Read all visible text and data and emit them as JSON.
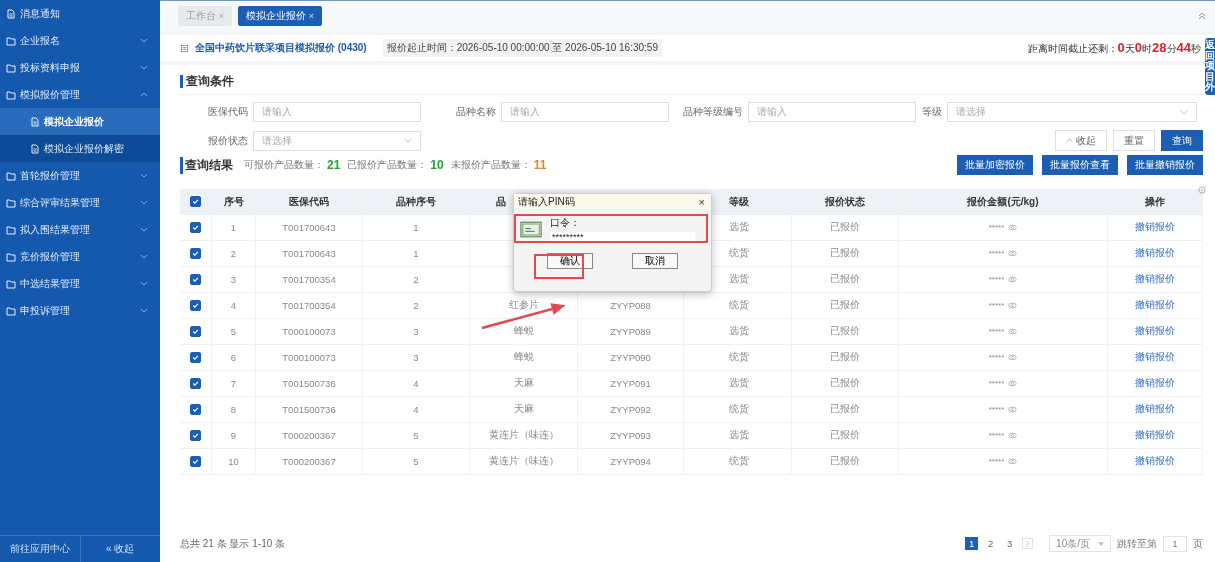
{
  "sidebar": {
    "items": [
      {
        "label": "消息通知",
        "kind": "leaf",
        "selected": false
      },
      {
        "label": "企业报名",
        "kind": "group",
        "expanded": false,
        "selected": false
      },
      {
        "label": "投标资料申报",
        "kind": "group",
        "expanded": false,
        "selected": false
      },
      {
        "label": "模拟报价管理",
        "kind": "group",
        "expanded": true,
        "selected": false,
        "children": [
          {
            "label": "模拟企业报价",
            "kind": "leaf",
            "selected": true
          },
          {
            "label": "模拟企业报价解密",
            "kind": "leaf",
            "selected": false
          }
        ]
      },
      {
        "label": "首轮报价管理",
        "kind": "group",
        "expanded": false,
        "selected": false
      },
      {
        "label": "综合评审结果管理",
        "kind": "group",
        "expanded": false,
        "selected": false
      },
      {
        "label": "拟入围结果管理",
        "kind": "group",
        "expanded": false,
        "selected": false
      },
      {
        "label": "竞价报价管理",
        "kind": "group",
        "expanded": false,
        "selected": false
      },
      {
        "label": "中选结果管理",
        "kind": "group",
        "expanded": false,
        "selected": false
      },
      {
        "label": "申投诉管理",
        "kind": "group",
        "expanded": false,
        "selected": false
      }
    ],
    "footer": [
      "前往应用中心",
      "« 收起"
    ]
  },
  "tabs": [
    {
      "label": "工作台",
      "close": "×",
      "selected": false
    },
    {
      "label": "模拟企业报价",
      "close": "×",
      "selected": true
    }
  ],
  "side_tab": "返回项目外",
  "info": {
    "title": "全国中药饮片联采项目模拟报价 (0430)",
    "period": "报价起止时间：2026-05-10 00:00:00 至 2026-05-10 16:30:59",
    "countdown": [
      {
        "kind": "unit",
        "text": "距离时间截止还剩："
      },
      {
        "kind": "number",
        "text": "0"
      },
      {
        "kind": "unit",
        "text": "天"
      },
      {
        "kind": "number",
        "text": "0"
      },
      {
        "kind": "unit",
        "text": "时"
      },
      {
        "kind": "number",
        "text": "28"
      },
      {
        "kind": "unit",
        "text": "分"
      },
      {
        "kind": "number",
        "text": "44"
      },
      {
        "kind": "unit",
        "text": "秒"
      }
    ]
  },
  "query": {
    "title": "查询条件",
    "fields": [
      {
        "label": "医保代码",
        "placeholder": "请输入",
        "kind": "input"
      },
      {
        "label": "品种名称",
        "placeholder": "请输入",
        "kind": "input"
      },
      {
        "label": "品种等级编号",
        "placeholder": "请输入",
        "kind": "input"
      },
      {
        "label": "等级",
        "placeholder": "请选择",
        "kind": "select"
      },
      {
        "label": "报价状态",
        "placeholder": "请选择",
        "kind": "select"
      }
    ],
    "buttons": [
      {
        "label": "收起",
        "kind": "collapse"
      },
      {
        "label": "重置",
        "kind": "plain"
      },
      {
        "label": "查询",
        "kind": "primary"
      }
    ]
  },
  "results": {
    "title": "查询结果",
    "counts": [
      {
        "label": "可报价产品数量：",
        "value": "21",
        "color": "#22a33a"
      },
      {
        "label": "已报价产品数量：",
        "value": "10",
        "color": "#22a33a"
      },
      {
        "label": "未报价产品数量：",
        "value": "11",
        "color": "#d88a2a"
      }
    ],
    "buttons": [
      "批量加密报价",
      "批量报价查看",
      "批量撤销报价"
    ]
  },
  "table": {
    "all_checked": true,
    "columns": [
      "序号",
      "医保代码",
      "品种序号",
      "品",
      "等级",
      "报价状态",
      "报价金额(元/kg)",
      "操作"
    ],
    "rows": [
      {
        "checked": true,
        "no": "1",
        "code": "T001700643",
        "variety_no": "1",
        "grade": "选货",
        "status": "已报价",
        "amount": "*****",
        "action": "撤销报价"
      },
      {
        "checked": true,
        "no": "2",
        "code": "T001700643",
        "variety_no": "1",
        "grade": "统货",
        "status": "已报价",
        "amount": "*****",
        "action": "撤销报价"
      },
      {
        "checked": true,
        "no": "3",
        "code": "T001700354",
        "variety_no": "2",
        "grade": "选货",
        "status": "已报价",
        "amount": "*****",
        "action": "撤销报价"
      },
      {
        "checked": true,
        "no": "4",
        "code": "T001700354",
        "variety_no": "2",
        "name": "红参片",
        "product_code": "ZYYP088",
        "grade": "统货",
        "status": "已报价",
        "amount": "*****",
        "action": "撤销报价"
      },
      {
        "checked": true,
        "no": "5",
        "code": "T000100073",
        "variety_no": "3",
        "name": "蜂蜕",
        "product_code": "ZYYP089",
        "grade": "选货",
        "status": "已报价",
        "amount": "*****",
        "action": "撤销报价"
      },
      {
        "checked": true,
        "no": "6",
        "code": "T000100073",
        "variety_no": "3",
        "name": "蜂蜕",
        "product_code": "ZYYP090",
        "grade": "统货",
        "status": "已报价",
        "amount": "*****",
        "action": "撤销报价"
      },
      {
        "checked": true,
        "no": "7",
        "code": "T001500736",
        "variety_no": "4",
        "name": "天麻",
        "product_code": "ZYYP091",
        "grade": "选货",
        "status": "已报价",
        "amount": "*****",
        "action": "撤销报价"
      },
      {
        "checked": true,
        "no": "8",
        "code": "T001500736",
        "variety_no": "4",
        "name": "天麻",
        "product_code": "ZYYP092",
        "grade": "统货",
        "status": "已报价",
        "amount": "*****",
        "action": "撤销报价"
      },
      {
        "checked": true,
        "no": "9",
        "code": "T000200367",
        "variety_no": "5",
        "name": "黄连片（味连）",
        "product_code": "ZYYP093",
        "grade": "选货",
        "status": "已报价",
        "amount": "*****",
        "action": "撤销报价"
      },
      {
        "checked": true,
        "no": "10",
        "code": "T000200367",
        "variety_no": "5",
        "name": "黄连片（味连）",
        "product_code": "ZYYP094",
        "grade": "统货",
        "status": "已报价",
        "amount": "*****",
        "action": "撤销报价"
      }
    ]
  },
  "footer": {
    "total": "总共 21 条 显示 1-10 条",
    "pages": [
      {
        "label": "1",
        "selected": true
      },
      {
        "label": "2",
        "selected": false
      },
      {
        "label": "3",
        "selected": false
      }
    ],
    "page_size": "10条/页",
    "jump_label": "跳转至第",
    "jump_value": "1",
    "jump_unit": "页"
  },
  "dialog": {
    "title": "请输入PIN码",
    "close": "×",
    "label": "口令：",
    "value": "*********",
    "buttons": [
      "确认",
      "取消"
    ]
  }
}
